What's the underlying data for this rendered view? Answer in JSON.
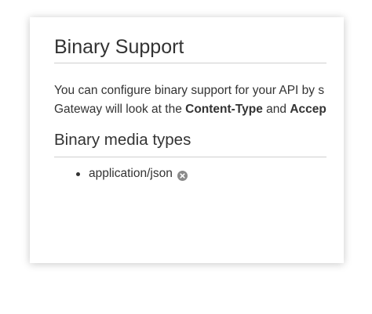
{
  "section": {
    "title": "Binary Support",
    "desc_line1": "You can configure binary support for your API by s",
    "desc_line2_a": "Gateway will look at the ",
    "desc_line2_b": "Content-Type",
    "desc_line2_c": " and ",
    "desc_line2_d": "Accep"
  },
  "binary_media": {
    "heading": "Binary media types",
    "types": [
      {
        "value": "application/json",
        "remove_icon": "remove-circle-icon"
      }
    ]
  },
  "colors": {
    "text": "#333333",
    "rule": "#cfcfcf",
    "icon": "#8a8a8a"
  }
}
